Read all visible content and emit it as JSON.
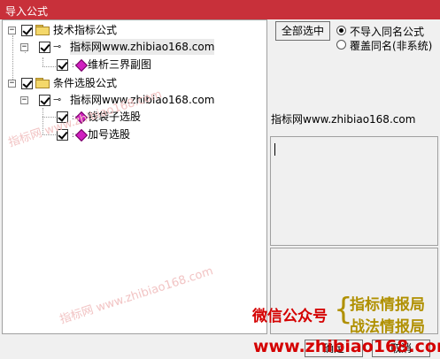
{
  "window": {
    "title": "导入公式"
  },
  "tree": {
    "groups": [
      {
        "label": "技术指标公式",
        "checked": true,
        "expanded": true,
        "source": "指标网www.zhibiao168.com",
        "items": [
          "维析三界副图"
        ]
      },
      {
        "label": "条件选股公式",
        "checked": true,
        "expanded": true,
        "source": "指标网www.zhibiao168.com",
        "items": [
          "钱袋子选股",
          "加号选股"
        ]
      }
    ]
  },
  "controls": {
    "select_all_label": "全部选中",
    "radio_options": [
      {
        "label": "不导入同名公式",
        "selected": true
      },
      {
        "label": "覆盖同名(非系统)",
        "selected": false
      }
    ],
    "info_text": "指标网www.zhibiao168.com"
  },
  "overlay": {
    "wechat_label": "微信公众号",
    "brace": "{",
    "name1": "指标情报局",
    "name2": "战法情报局",
    "url": "www.zhibiao168.com",
    "watermark": "指标网  www.zhibiao168.com"
  },
  "buttons": {
    "ok": "确定",
    "cancel": "取消"
  },
  "colors": {
    "title_bg": "#c8303a",
    "ad_red": "#d40000",
    "ad_olive": "#b09000"
  }
}
